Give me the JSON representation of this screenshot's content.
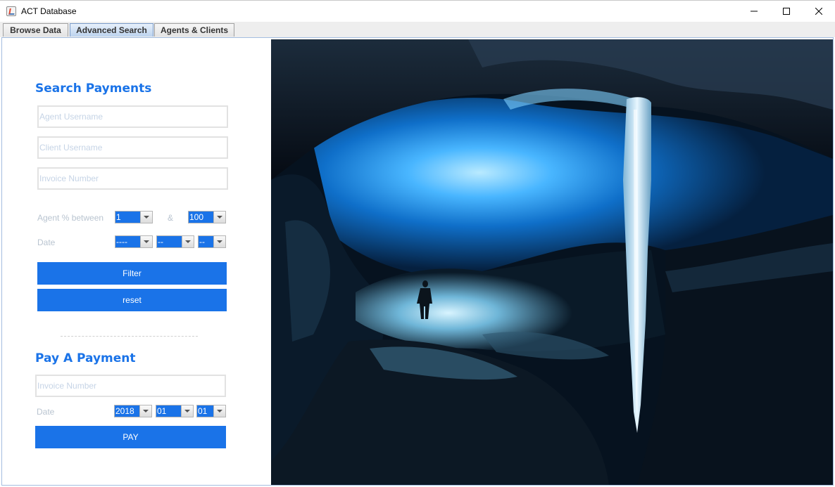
{
  "window": {
    "title": "ACT Database",
    "icon": "java-cup-icon",
    "controls": [
      "minimize-icon",
      "maximize-icon",
      "close-icon"
    ]
  },
  "tabs": [
    {
      "label": "Browse Data",
      "active": false
    },
    {
      "label": "Advanced Search",
      "active": true
    },
    {
      "label": "Agents & Clients",
      "active": false
    }
  ],
  "search": {
    "heading": "Search Payments",
    "agent_placeholder": "Agent Username",
    "client_placeholder": "Client Username",
    "invoice_placeholder": "Invoice Number",
    "agent_pct_label": "Agent % between",
    "and_label": "&",
    "pct_min": "1",
    "pct_max": "100",
    "date_label": "Date",
    "date_year": "----",
    "date_month": "--",
    "date_day": "--",
    "filter_label": "Filter",
    "reset_label": "reset"
  },
  "pay": {
    "heading": "Pay A Payment",
    "invoice_placeholder": "Invoice Number",
    "date_label": "Date",
    "year": "2018",
    "month": "01",
    "day": "01",
    "pay_label": "PAY"
  },
  "colors": {
    "accent": "#1a73e8",
    "label_muted": "#b9c4d0",
    "tab_active": "#bcd3ee"
  },
  "image": {
    "subject": "ice-cave-photo"
  }
}
